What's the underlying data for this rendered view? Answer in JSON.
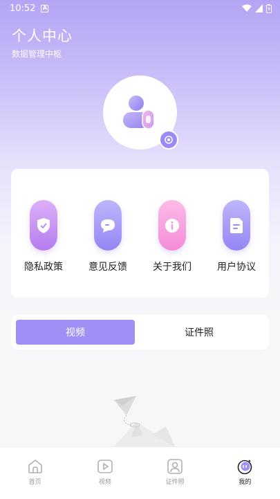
{
  "status_bar": {
    "time": "10:52",
    "a_badge": "A",
    "icons": [
      "wifi-icon",
      "signal-icon",
      "battery-icon"
    ]
  },
  "header": {
    "title": "个人中心",
    "subtitle": "数据管理中枢"
  },
  "avatar": {
    "icon": "user-profile-icon",
    "edit_icon": "camera-icon"
  },
  "menu": [
    {
      "label": "隐私政策",
      "icon": "shield-check-icon",
      "color_from": "#d6a8f7",
      "color_to": "#b87df0"
    },
    {
      "label": "意见反馈",
      "icon": "chat-bubble-icon",
      "color_from": "#b8b0fa",
      "color_to": "#9588f4"
    },
    {
      "label": "关于我们",
      "icon": "info-icon",
      "color_from": "#fbb5e6",
      "color_to": "#f58fd8"
    },
    {
      "label": "用户协议",
      "icon": "document-icon",
      "color_from": "#b8b0fa",
      "color_to": "#9588f4"
    }
  ],
  "tabs": [
    {
      "label": "视频",
      "active": true
    },
    {
      "label": "证件照",
      "active": false
    }
  ],
  "bottom_nav": [
    {
      "label": "首页",
      "icon": "home-icon",
      "active": false
    },
    {
      "label": "视频",
      "icon": "video-play-icon",
      "active": false
    },
    {
      "label": "证件照",
      "icon": "id-photo-icon",
      "active": false
    },
    {
      "label": "我的",
      "icon": "profile-face-icon",
      "active": true
    }
  ],
  "colors": {
    "accent": "#9f90f6",
    "gradient_top": "#b4a4f5"
  }
}
